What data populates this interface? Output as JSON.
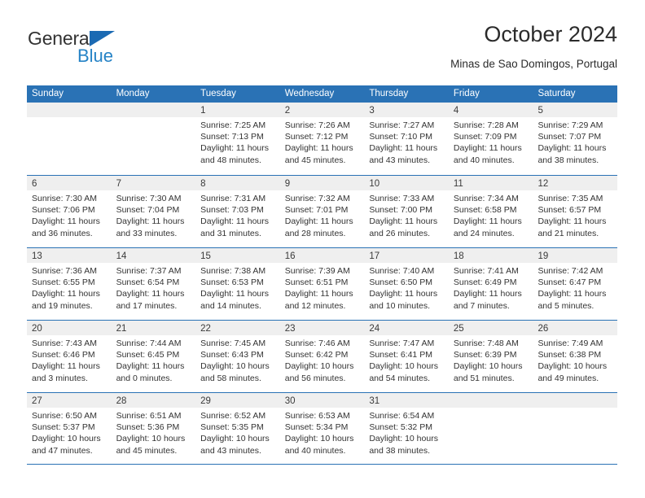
{
  "brand": {
    "name_part1": "General",
    "name_part2": "Blue",
    "triangle_color": "#1b6ab3",
    "blue_color": "#2683c6"
  },
  "header": {
    "title": "October 2024",
    "subtitle": "Minas de Sao Domingos, Portugal"
  },
  "theme": {
    "header_blue": "#2a72b5",
    "day_band_gray": "#efefef",
    "text": "#333333"
  },
  "calendar": {
    "weekdays": [
      "Sunday",
      "Monday",
      "Tuesday",
      "Wednesday",
      "Thursday",
      "Friday",
      "Saturday"
    ],
    "weeks": [
      [
        {
          "day": "",
          "lines": []
        },
        {
          "day": "",
          "lines": []
        },
        {
          "day": "1",
          "lines": [
            "Sunrise: 7:25 AM",
            "Sunset: 7:13 PM",
            "Daylight: 11 hours",
            "and 48 minutes."
          ]
        },
        {
          "day": "2",
          "lines": [
            "Sunrise: 7:26 AM",
            "Sunset: 7:12 PM",
            "Daylight: 11 hours",
            "and 45 minutes."
          ]
        },
        {
          "day": "3",
          "lines": [
            "Sunrise: 7:27 AM",
            "Sunset: 7:10 PM",
            "Daylight: 11 hours",
            "and 43 minutes."
          ]
        },
        {
          "day": "4",
          "lines": [
            "Sunrise: 7:28 AM",
            "Sunset: 7:09 PM",
            "Daylight: 11 hours",
            "and 40 minutes."
          ]
        },
        {
          "day": "5",
          "lines": [
            "Sunrise: 7:29 AM",
            "Sunset: 7:07 PM",
            "Daylight: 11 hours",
            "and 38 minutes."
          ]
        }
      ],
      [
        {
          "day": "6",
          "lines": [
            "Sunrise: 7:30 AM",
            "Sunset: 7:06 PM",
            "Daylight: 11 hours",
            "and 36 minutes."
          ]
        },
        {
          "day": "7",
          "lines": [
            "Sunrise: 7:30 AM",
            "Sunset: 7:04 PM",
            "Daylight: 11 hours",
            "and 33 minutes."
          ]
        },
        {
          "day": "8",
          "lines": [
            "Sunrise: 7:31 AM",
            "Sunset: 7:03 PM",
            "Daylight: 11 hours",
            "and 31 minutes."
          ]
        },
        {
          "day": "9",
          "lines": [
            "Sunrise: 7:32 AM",
            "Sunset: 7:01 PM",
            "Daylight: 11 hours",
            "and 28 minutes."
          ]
        },
        {
          "day": "10",
          "lines": [
            "Sunrise: 7:33 AM",
            "Sunset: 7:00 PM",
            "Daylight: 11 hours",
            "and 26 minutes."
          ]
        },
        {
          "day": "11",
          "lines": [
            "Sunrise: 7:34 AM",
            "Sunset: 6:58 PM",
            "Daylight: 11 hours",
            "and 24 minutes."
          ]
        },
        {
          "day": "12",
          "lines": [
            "Sunrise: 7:35 AM",
            "Sunset: 6:57 PM",
            "Daylight: 11 hours",
            "and 21 minutes."
          ]
        }
      ],
      [
        {
          "day": "13",
          "lines": [
            "Sunrise: 7:36 AM",
            "Sunset: 6:55 PM",
            "Daylight: 11 hours",
            "and 19 minutes."
          ]
        },
        {
          "day": "14",
          "lines": [
            "Sunrise: 7:37 AM",
            "Sunset: 6:54 PM",
            "Daylight: 11 hours",
            "and 17 minutes."
          ]
        },
        {
          "day": "15",
          "lines": [
            "Sunrise: 7:38 AM",
            "Sunset: 6:53 PM",
            "Daylight: 11 hours",
            "and 14 minutes."
          ]
        },
        {
          "day": "16",
          "lines": [
            "Sunrise: 7:39 AM",
            "Sunset: 6:51 PM",
            "Daylight: 11 hours",
            "and 12 minutes."
          ]
        },
        {
          "day": "17",
          "lines": [
            "Sunrise: 7:40 AM",
            "Sunset: 6:50 PM",
            "Daylight: 11 hours",
            "and 10 minutes."
          ]
        },
        {
          "day": "18",
          "lines": [
            "Sunrise: 7:41 AM",
            "Sunset: 6:49 PM",
            "Daylight: 11 hours",
            "and 7 minutes."
          ]
        },
        {
          "day": "19",
          "lines": [
            "Sunrise: 7:42 AM",
            "Sunset: 6:47 PM",
            "Daylight: 11 hours",
            "and 5 minutes."
          ]
        }
      ],
      [
        {
          "day": "20",
          "lines": [
            "Sunrise: 7:43 AM",
            "Sunset: 6:46 PM",
            "Daylight: 11 hours",
            "and 3 minutes."
          ]
        },
        {
          "day": "21",
          "lines": [
            "Sunrise: 7:44 AM",
            "Sunset: 6:45 PM",
            "Daylight: 11 hours",
            "and 0 minutes."
          ]
        },
        {
          "day": "22",
          "lines": [
            "Sunrise: 7:45 AM",
            "Sunset: 6:43 PM",
            "Daylight: 10 hours",
            "and 58 minutes."
          ]
        },
        {
          "day": "23",
          "lines": [
            "Sunrise: 7:46 AM",
            "Sunset: 6:42 PM",
            "Daylight: 10 hours",
            "and 56 minutes."
          ]
        },
        {
          "day": "24",
          "lines": [
            "Sunrise: 7:47 AM",
            "Sunset: 6:41 PM",
            "Daylight: 10 hours",
            "and 54 minutes."
          ]
        },
        {
          "day": "25",
          "lines": [
            "Sunrise: 7:48 AM",
            "Sunset: 6:39 PM",
            "Daylight: 10 hours",
            "and 51 minutes."
          ]
        },
        {
          "day": "26",
          "lines": [
            "Sunrise: 7:49 AM",
            "Sunset: 6:38 PM",
            "Daylight: 10 hours",
            "and 49 minutes."
          ]
        }
      ],
      [
        {
          "day": "27",
          "lines": [
            "Sunrise: 6:50 AM",
            "Sunset: 5:37 PM",
            "Daylight: 10 hours",
            "and 47 minutes."
          ]
        },
        {
          "day": "28",
          "lines": [
            "Sunrise: 6:51 AM",
            "Sunset: 5:36 PM",
            "Daylight: 10 hours",
            "and 45 minutes."
          ]
        },
        {
          "day": "29",
          "lines": [
            "Sunrise: 6:52 AM",
            "Sunset: 5:35 PM",
            "Daylight: 10 hours",
            "and 43 minutes."
          ]
        },
        {
          "day": "30",
          "lines": [
            "Sunrise: 6:53 AM",
            "Sunset: 5:34 PM",
            "Daylight: 10 hours",
            "and 40 minutes."
          ]
        },
        {
          "day": "31",
          "lines": [
            "Sunrise: 6:54 AM",
            "Sunset: 5:32 PM",
            "Daylight: 10 hours",
            "and 38 minutes."
          ]
        },
        {
          "day": "",
          "lines": []
        },
        {
          "day": "",
          "lines": []
        }
      ]
    ]
  }
}
